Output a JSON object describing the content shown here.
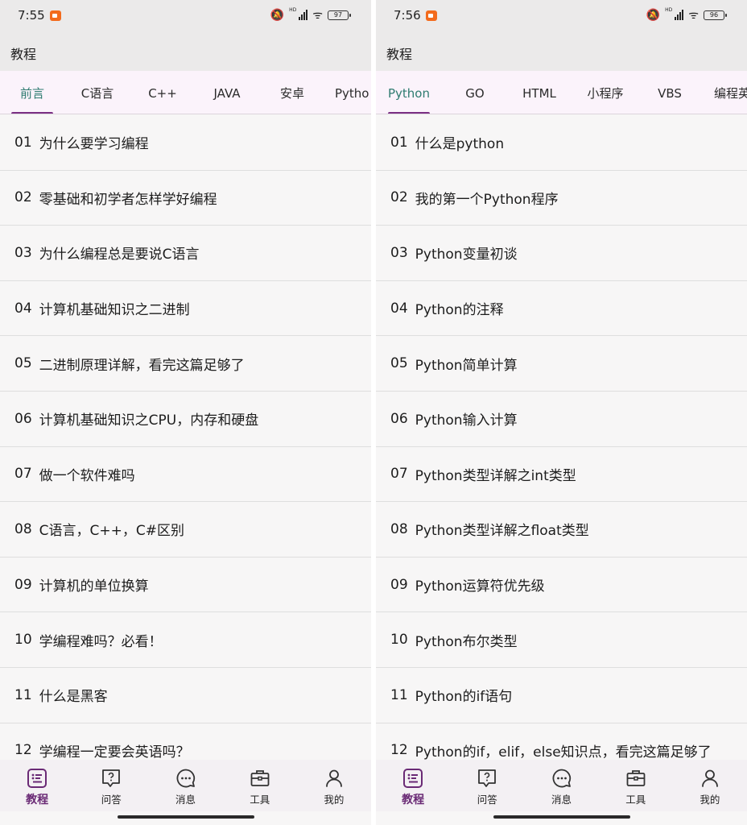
{
  "screens": [
    {
      "status": {
        "time": "7:55",
        "battery": "97"
      },
      "app_title": "教程",
      "tabs": [
        {
          "label": "前言",
          "active": true
        },
        {
          "label": "C语言"
        },
        {
          "label": "C++"
        },
        {
          "label": "JAVA"
        },
        {
          "label": "安卓"
        },
        {
          "label": "Pytho"
        }
      ],
      "items": [
        {
          "num": "01",
          "title": "为什么要学习编程"
        },
        {
          "num": "02",
          "title": "零基础和初学者怎样学好编程"
        },
        {
          "num": "03",
          "title": "为什么编程总是要说C语言"
        },
        {
          "num": "04",
          "title": "计算机基础知识之二进制"
        },
        {
          "num": "05",
          "title": "二进制原理详解，看完这篇足够了"
        },
        {
          "num": "06",
          "title": "计算机基础知识之CPU，内存和硬盘"
        },
        {
          "num": "07",
          "title": "做一个软件难吗"
        },
        {
          "num": "08",
          "title": "C语言，C++，C#区别"
        },
        {
          "num": "09",
          "title": "计算机的单位换算"
        },
        {
          "num": "10",
          "title": "学编程难吗？必看！"
        },
        {
          "num": "11",
          "title": "什么是黑客"
        },
        {
          "num": "12",
          "title": "学编程一定要会英语吗？"
        }
      ],
      "nav": [
        {
          "label": "教程",
          "icon": "list-icon",
          "active": true
        },
        {
          "label": "问答",
          "icon": "question-icon"
        },
        {
          "label": "消息",
          "icon": "chat-icon"
        },
        {
          "label": "工具",
          "icon": "toolbox-icon"
        },
        {
          "label": "我的",
          "icon": "person-icon"
        }
      ]
    },
    {
      "status": {
        "time": "7:56",
        "battery": "96"
      },
      "app_title": "教程",
      "tabs": [
        {
          "label": "Python",
          "active": true
        },
        {
          "label": "GO"
        },
        {
          "label": "HTML"
        },
        {
          "label": "小程序"
        },
        {
          "label": "VBS"
        },
        {
          "label": "编程英"
        }
      ],
      "items": [
        {
          "num": "01",
          "title": "什么是python"
        },
        {
          "num": "02",
          "title": "我的第一个Python程序"
        },
        {
          "num": "03",
          "title": "Python变量初谈"
        },
        {
          "num": "04",
          "title": "Python的注释"
        },
        {
          "num": "05",
          "title": "Python简单计算"
        },
        {
          "num": "06",
          "title": "Python输入计算"
        },
        {
          "num": "07",
          "title": "Python类型详解之int类型"
        },
        {
          "num": "08",
          "title": "Python类型详解之float类型"
        },
        {
          "num": "09",
          "title": "Python运算符优先级"
        },
        {
          "num": "10",
          "title": "Python布尔类型"
        },
        {
          "num": "11",
          "title": "Python的if语句"
        },
        {
          "num": "12",
          "title": "Python的if，elif，else知识点，看完这篇足够了"
        }
      ],
      "nav": [
        {
          "label": "教程",
          "icon": "list-icon",
          "active": true
        },
        {
          "label": "问答",
          "icon": "question-icon"
        },
        {
          "label": "消息",
          "icon": "chat-icon"
        },
        {
          "label": "工具",
          "icon": "toolbox-icon"
        },
        {
          "label": "我的",
          "icon": "person-icon"
        }
      ],
      "colors": {
        "accent": "#7a2f83",
        "active_tab_text": "#2e7b70",
        "tab_bg": "#fbf3fb"
      }
    }
  ]
}
